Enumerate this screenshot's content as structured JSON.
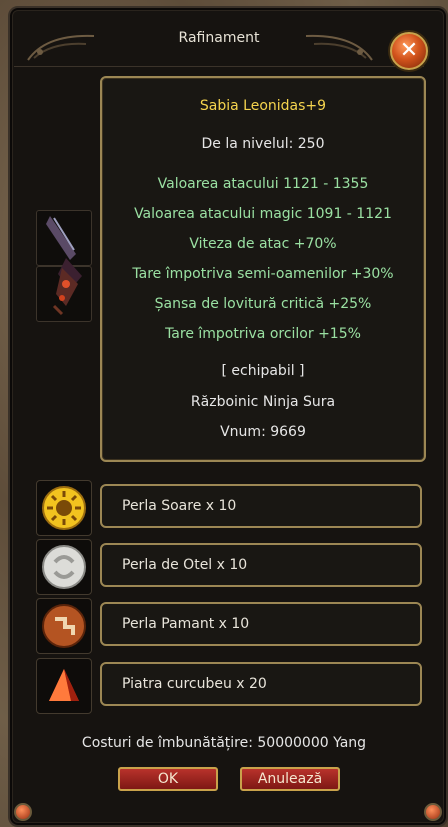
{
  "window": {
    "title": "Rafinament",
    "close_icon": "close-x-icon"
  },
  "item": {
    "name": "Sabia Leonidas+9",
    "level_req": "De la nivelul: 250",
    "stats": [
      "Valoarea atacului 1121 - 1355",
      "Valoarea atacului magic 1091 - 1121",
      "Viteza de atac +70%",
      "Tare împotriva semi-oamenilor +30%",
      "Șansa de lovitură critică +25%",
      "Tare împotriva orcilor +15%"
    ],
    "equip_state": "[ echipabil ]",
    "class": "Războinic Ninja Sura",
    "vnum": "Vnum: 9669",
    "icon": "sword-icon"
  },
  "materials": [
    {
      "label": "Perla Soare x 10",
      "icon": "sun-pearl-icon"
    },
    {
      "label": "Perla de Otel x 10",
      "icon": "steel-pearl-icon"
    },
    {
      "label": "Perla Pamant x 10",
      "icon": "earth-pearl-icon"
    },
    {
      "label": "Piatra curcubeu x 20",
      "icon": "rainbow-stone-icon"
    }
  ],
  "cost_text": "Costuri de îmbunătățire: 50000000 Yang",
  "buttons": {
    "ok": "OK",
    "cancel": "Anulează"
  },
  "colors": {
    "item_name": "#f5d44e",
    "bonus": "#9ae0a2",
    "frame_gold": "#9c8754",
    "button_red": "#b8322b"
  }
}
